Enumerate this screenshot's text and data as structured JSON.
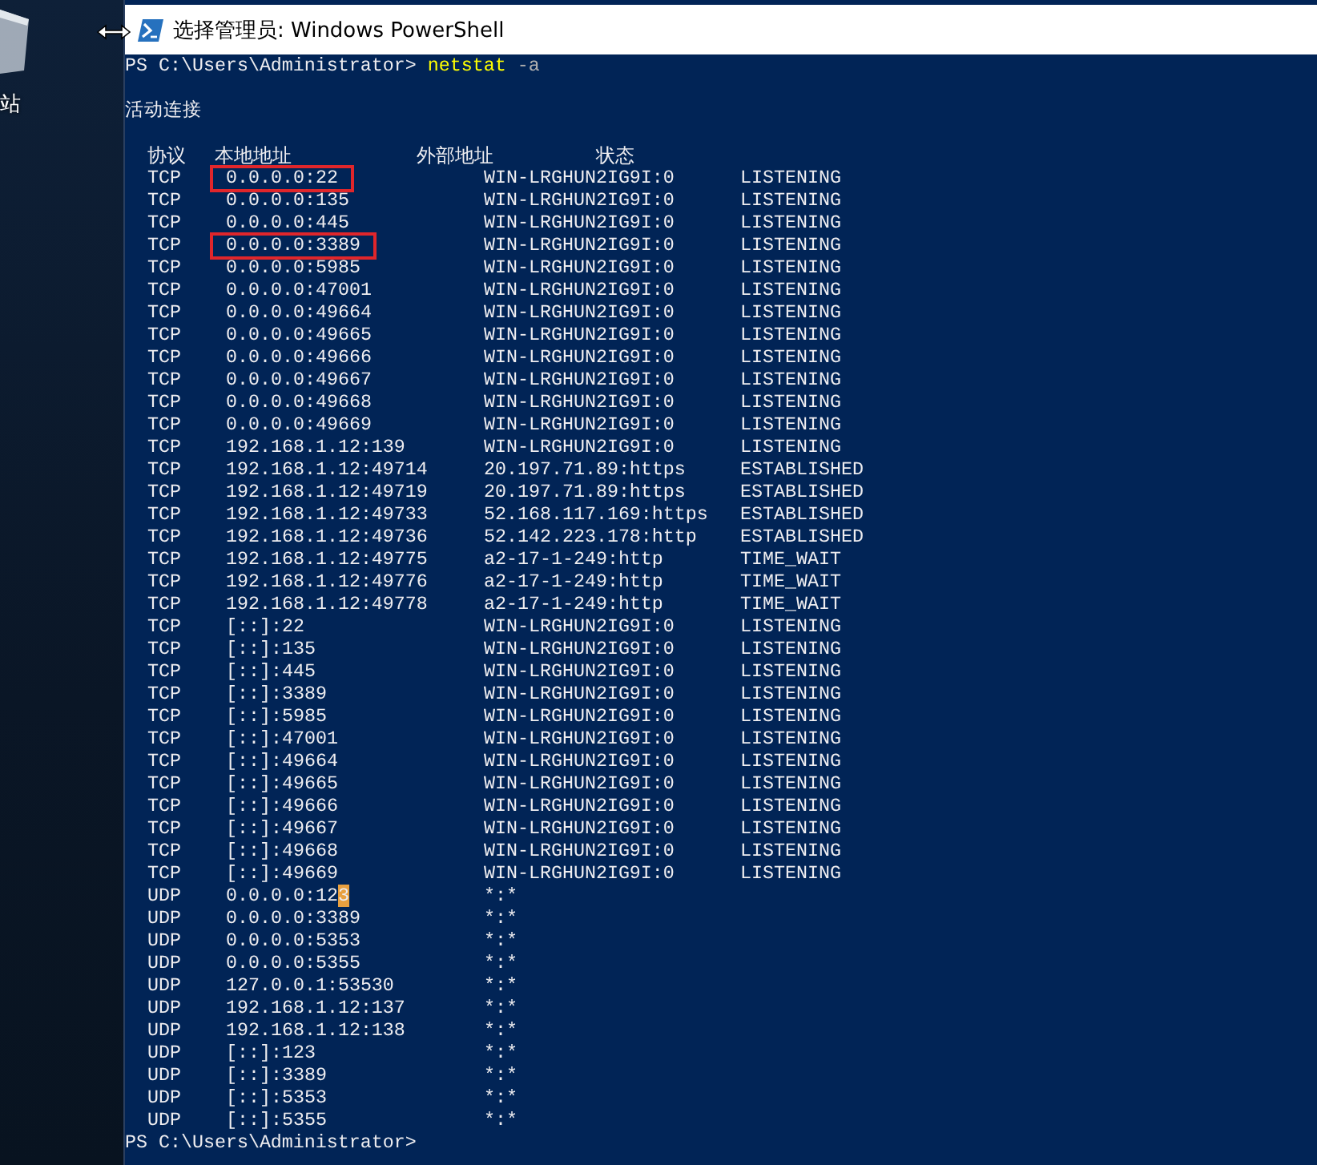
{
  "desktop": {
    "icon_label": "站"
  },
  "window": {
    "title": "选择管理员: Windows PowerShell"
  },
  "console": {
    "prompt": "PS C:\\Users\\Administrator>",
    "command": "netstat",
    "argument": "-a",
    "heading": "活动连接",
    "columns": [
      "协议",
      "本地地址",
      "外部地址",
      "状态"
    ],
    "rows": [
      {
        "proto": "TCP",
        "local": "0.0.0.0:22",
        "foreign": "WIN-LRGHUN2IG9I:0",
        "state": "LISTENING",
        "boxed": true,
        "cursor": false
      },
      {
        "proto": "TCP",
        "local": "0.0.0.0:135",
        "foreign": "WIN-LRGHUN2IG9I:0",
        "state": "LISTENING",
        "boxed": false,
        "cursor": false
      },
      {
        "proto": "TCP",
        "local": "0.0.0.0:445",
        "foreign": "WIN-LRGHUN2IG9I:0",
        "state": "LISTENING",
        "boxed": false,
        "cursor": false
      },
      {
        "proto": "TCP",
        "local": "0.0.0.0:3389",
        "foreign": "WIN-LRGHUN2IG9I:0",
        "state": "LISTENING",
        "boxed": true,
        "cursor": false
      },
      {
        "proto": "TCP",
        "local": "0.0.0.0:5985",
        "foreign": "WIN-LRGHUN2IG9I:0",
        "state": "LISTENING",
        "boxed": false,
        "cursor": false
      },
      {
        "proto": "TCP",
        "local": "0.0.0.0:47001",
        "foreign": "WIN-LRGHUN2IG9I:0",
        "state": "LISTENING",
        "boxed": false,
        "cursor": false
      },
      {
        "proto": "TCP",
        "local": "0.0.0.0:49664",
        "foreign": "WIN-LRGHUN2IG9I:0",
        "state": "LISTENING",
        "boxed": false,
        "cursor": false
      },
      {
        "proto": "TCP",
        "local": "0.0.0.0:49665",
        "foreign": "WIN-LRGHUN2IG9I:0",
        "state": "LISTENING",
        "boxed": false,
        "cursor": false
      },
      {
        "proto": "TCP",
        "local": "0.0.0.0:49666",
        "foreign": "WIN-LRGHUN2IG9I:0",
        "state": "LISTENING",
        "boxed": false,
        "cursor": false
      },
      {
        "proto": "TCP",
        "local": "0.0.0.0:49667",
        "foreign": "WIN-LRGHUN2IG9I:0",
        "state": "LISTENING",
        "boxed": false,
        "cursor": false
      },
      {
        "proto": "TCP",
        "local": "0.0.0.0:49668",
        "foreign": "WIN-LRGHUN2IG9I:0",
        "state": "LISTENING",
        "boxed": false,
        "cursor": false
      },
      {
        "proto": "TCP",
        "local": "0.0.0.0:49669",
        "foreign": "WIN-LRGHUN2IG9I:0",
        "state": "LISTENING",
        "boxed": false,
        "cursor": false
      },
      {
        "proto": "TCP",
        "local": "192.168.1.12:139",
        "foreign": "WIN-LRGHUN2IG9I:0",
        "state": "LISTENING",
        "boxed": false,
        "cursor": false
      },
      {
        "proto": "TCP",
        "local": "192.168.1.12:49714",
        "foreign": "20.197.71.89:https",
        "state": "ESTABLISHED",
        "boxed": false,
        "cursor": false
      },
      {
        "proto": "TCP",
        "local": "192.168.1.12:49719",
        "foreign": "20.197.71.89:https",
        "state": "ESTABLISHED",
        "boxed": false,
        "cursor": false
      },
      {
        "proto": "TCP",
        "local": "192.168.1.12:49733",
        "foreign": "52.168.117.169:https",
        "state": "ESTABLISHED",
        "boxed": false,
        "cursor": false
      },
      {
        "proto": "TCP",
        "local": "192.168.1.12:49736",
        "foreign": "52.142.223.178:http",
        "state": "ESTABLISHED",
        "boxed": false,
        "cursor": false
      },
      {
        "proto": "TCP",
        "local": "192.168.1.12:49775",
        "foreign": "a2-17-1-249:http",
        "state": "TIME_WAIT",
        "boxed": false,
        "cursor": false
      },
      {
        "proto": "TCP",
        "local": "192.168.1.12:49776",
        "foreign": "a2-17-1-249:http",
        "state": "TIME_WAIT",
        "boxed": false,
        "cursor": false
      },
      {
        "proto": "TCP",
        "local": "192.168.1.12:49778",
        "foreign": "a2-17-1-249:http",
        "state": "TIME_WAIT",
        "boxed": false,
        "cursor": false
      },
      {
        "proto": "TCP",
        "local": "[::]:22",
        "foreign": "WIN-LRGHUN2IG9I:0",
        "state": "LISTENING",
        "boxed": false,
        "cursor": false
      },
      {
        "proto": "TCP",
        "local": "[::]:135",
        "foreign": "WIN-LRGHUN2IG9I:0",
        "state": "LISTENING",
        "boxed": false,
        "cursor": false
      },
      {
        "proto": "TCP",
        "local": "[::]:445",
        "foreign": "WIN-LRGHUN2IG9I:0",
        "state": "LISTENING",
        "boxed": false,
        "cursor": false
      },
      {
        "proto": "TCP",
        "local": "[::]:3389",
        "foreign": "WIN-LRGHUN2IG9I:0",
        "state": "LISTENING",
        "boxed": false,
        "cursor": false
      },
      {
        "proto": "TCP",
        "local": "[::]:5985",
        "foreign": "WIN-LRGHUN2IG9I:0",
        "state": "LISTENING",
        "boxed": false,
        "cursor": false
      },
      {
        "proto": "TCP",
        "local": "[::]:47001",
        "foreign": "WIN-LRGHUN2IG9I:0",
        "state": "LISTENING",
        "boxed": false,
        "cursor": false
      },
      {
        "proto": "TCP",
        "local": "[::]:49664",
        "foreign": "WIN-LRGHUN2IG9I:0",
        "state": "LISTENING",
        "boxed": false,
        "cursor": false
      },
      {
        "proto": "TCP",
        "local": "[::]:49665",
        "foreign": "WIN-LRGHUN2IG9I:0",
        "state": "LISTENING",
        "boxed": false,
        "cursor": false
      },
      {
        "proto": "TCP",
        "local": "[::]:49666",
        "foreign": "WIN-LRGHUN2IG9I:0",
        "state": "LISTENING",
        "boxed": false,
        "cursor": false
      },
      {
        "proto": "TCP",
        "local": "[::]:49667",
        "foreign": "WIN-LRGHUN2IG9I:0",
        "state": "LISTENING",
        "boxed": false,
        "cursor": false
      },
      {
        "proto": "TCP",
        "local": "[::]:49668",
        "foreign": "WIN-LRGHUN2IG9I:0",
        "state": "LISTENING",
        "boxed": false,
        "cursor": false
      },
      {
        "proto": "TCP",
        "local": "[::]:49669",
        "foreign": "WIN-LRGHUN2IG9I:0",
        "state": "LISTENING",
        "boxed": false,
        "cursor": false
      },
      {
        "proto": "UDP",
        "local": "0.0.0.0:123",
        "foreign": "*:*",
        "boxed": false,
        "cursor": true
      },
      {
        "proto": "UDP",
        "local": "0.0.0.0:3389",
        "foreign": "*:*",
        "boxed": false,
        "cursor": false
      },
      {
        "proto": "UDP",
        "local": "0.0.0.0:5353",
        "foreign": "*:*",
        "boxed": false,
        "cursor": false
      },
      {
        "proto": "UDP",
        "local": "0.0.0.0:5355",
        "foreign": "*:*",
        "boxed": false,
        "cursor": false
      },
      {
        "proto": "UDP",
        "local": "127.0.0.1:53530",
        "foreign": "*:*",
        "boxed": false,
        "cursor": false
      },
      {
        "proto": "UDP",
        "local": "192.168.1.12:137",
        "foreign": "*:*",
        "boxed": false,
        "cursor": false
      },
      {
        "proto": "UDP",
        "local": "192.168.1.12:138",
        "foreign": "*:*",
        "boxed": false,
        "cursor": false
      },
      {
        "proto": "UDP",
        "local": "[::]:123",
        "foreign": "*:*",
        "boxed": false,
        "cursor": false
      },
      {
        "proto": "UDP",
        "local": "[::]:3389",
        "foreign": "*:*",
        "boxed": false,
        "cursor": false
      },
      {
        "proto": "UDP",
        "local": "[::]:5353",
        "foreign": "*:*",
        "boxed": false,
        "cursor": false
      },
      {
        "proto": "UDP",
        "local": "[::]:5355",
        "foreign": "*:*",
        "boxed": false,
        "cursor": false
      }
    ],
    "final_prompt": "PS C:\\Users\\Administrator>"
  }
}
